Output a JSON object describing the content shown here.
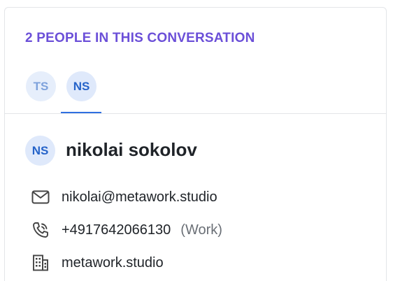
{
  "heading": "2 PEOPLE IN THIS CONVERSATION",
  "participants": [
    {
      "initials": "TS",
      "bg": "#e6eefb",
      "fg": "#7ea2dc"
    },
    {
      "initials": "NS",
      "bg": "#dfe9fb",
      "fg": "#2563c9"
    }
  ],
  "active_participant_index": 1,
  "contact": {
    "initials": "NS",
    "name": "nikolai sokolov",
    "email": "nikolai@metawork.studio",
    "phone": "+4917642066130",
    "phone_type": "(Work)",
    "company": "metawork.studio"
  },
  "icons": {
    "email": "envelope-icon",
    "phone": "phone-icon",
    "company": "building-icon"
  },
  "colors": {
    "heading": "#6b4fd8",
    "active_tab_underline": "#2f6fe0",
    "avatar_bg": "#dfe9fb",
    "avatar_fg": "#2563c9"
  }
}
